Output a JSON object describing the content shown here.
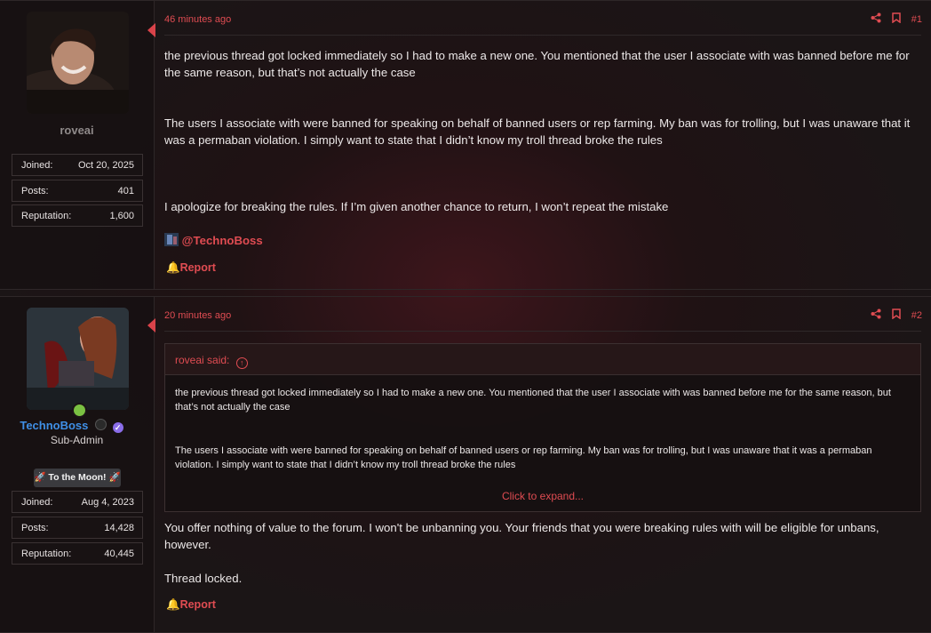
{
  "posts": [
    {
      "user": {
        "name": "roveai",
        "stats": [
          {
            "label": "Joined:",
            "value": "Oct 20, 2025"
          },
          {
            "label": "Posts:",
            "value": "401"
          },
          {
            "label": "Reputation:",
            "value": "1,600"
          }
        ]
      },
      "time": "46 minutes ago",
      "number": "#1",
      "paragraphs": [
        "the previous thread got locked immediately so I had to make a new one. You mentioned that the user I associate with was banned before me for the same reason, but that’s not actually the case",
        "The users I associate with were banned for speaking on behalf of banned users or rep farming. My ban was for trolling, but I was unaware that it was a permaban violation. I simply want to state that I didn’t know my troll thread broke the rules",
        "I apologize for breaking the rules. If I’m given another chance to return, I won’t repeat the mistake"
      ],
      "mention": "@TechnoBoss",
      "report_label": "Report"
    },
    {
      "user": {
        "name": "TechnoBoss",
        "title": "Sub-Admin",
        "badge": "🚀 To the Moon! 🚀",
        "stats": [
          {
            "label": "Joined:",
            "value": "Aug 4, 2023"
          },
          {
            "label": "Posts:",
            "value": "14,428"
          },
          {
            "label": "Reputation:",
            "value": "40,445"
          }
        ]
      },
      "time": "20 minutes ago",
      "number": "#2",
      "quote": {
        "author": "roveai said:",
        "paragraphs": [
          "the previous thread got locked immediately so I had to make a new one. You mentioned that the user I associate with was banned before me for the same reason, but that’s not actually the case",
          "The users I associate with were banned for speaking on behalf of banned users or rep farming. My ban was for trolling, but I was unaware that it was a permaban violation. I simply want to state that I didn’t know my troll thread broke the rules"
        ],
        "expand_label": "Click to expand..."
      },
      "paragraphs": [
        "You offer nothing of value to the forum. I won't be unbanning you. Your friends that you were breaking rules with will be eligible for unbans, however.",
        "Thread locked."
      ],
      "report_label": "Report"
    }
  ],
  "colors": {
    "accent": "#e04c52",
    "username_blue": "#3f8fe6",
    "online": "#7ac142",
    "verified": "#8a6de9"
  }
}
